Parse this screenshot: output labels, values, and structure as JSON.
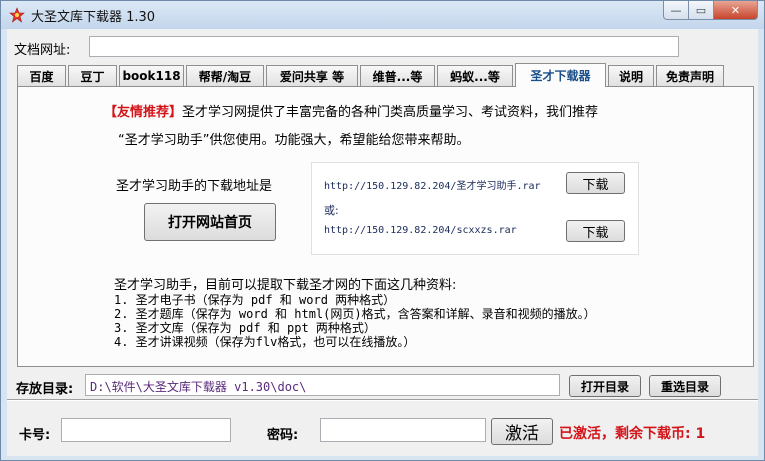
{
  "window": {
    "title": "大圣文库下载器 1.30",
    "minimize_glyph": "—",
    "maximize_glyph": "▭",
    "close_glyph": "✕"
  },
  "url_row": {
    "label": "文档网址:",
    "value": ""
  },
  "tabs": [
    {
      "label": "百度"
    },
    {
      "label": "豆丁"
    },
    {
      "label": "book118"
    },
    {
      "label": "帮帮/淘豆"
    },
    {
      "label": "爱问共享 等"
    },
    {
      "label": "维普...等"
    },
    {
      "label": "蚂蚁...等"
    },
    {
      "label": "圣才下载器",
      "active": true
    },
    {
      "label": "说明"
    },
    {
      "label": "免责声明"
    }
  ],
  "panel": {
    "recommend_tag": "【友情推荐】",
    "recommend_line1": "圣才学习网提供了丰富完备的各种门类高质量学习、考试资料，我们推荐",
    "recommend_line2": "“圣才学习助手”供您使用。功能强大，希望能给您带来帮助。",
    "download_address_label": "圣才学习助手的下载地址是",
    "open_site_button": "打开网站首页",
    "url1": "http://150.129.82.204/圣才学习助手.rar",
    "or_label": "或:",
    "url2": "http://150.129.82.204/scxxzs.rar",
    "download_button_1": "下载",
    "download_button_2": "下载",
    "features_intro": "圣才学习助手，目前可以提取下载圣才网的下面这几种资料:",
    "features": [
      "1. 圣才电子书（保存为 pdf 和 word 两种格式）",
      "2. 圣才题库（保存为 word 和 html(网页)格式，含答案和详解、录音和视频的播放。）",
      "3. 圣才文库（保存为 pdf 和 ppt 两种格式）",
      "4. 圣才讲课视频（保存为flv格式，也可以在线播放。）"
    ]
  },
  "save_row": {
    "label": "存放目录:",
    "path": "D:\\软件\\大圣文库下载器 v1.30\\doc\\",
    "open_dir_button": "打开目录",
    "reselect_dir_button": "重选目录"
  },
  "activation": {
    "card_label": "卡号:",
    "card_value": "",
    "password_label": "密码:",
    "password_value": "",
    "activate_button": "激活",
    "status": "已激活，剩余下载币: 1"
  }
}
